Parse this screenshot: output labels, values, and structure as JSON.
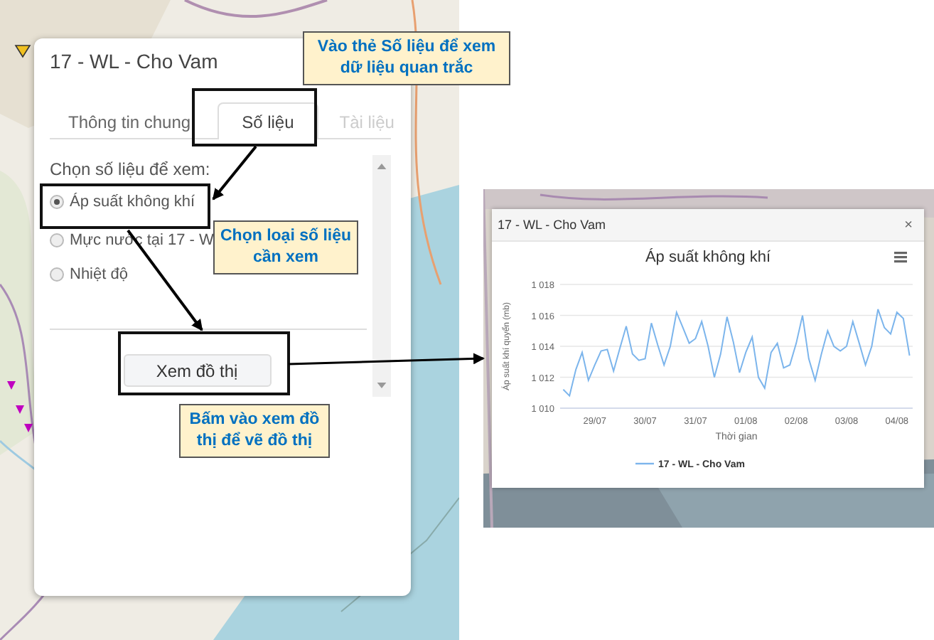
{
  "popup": {
    "title": "17 - WL - Cho Vam",
    "tabs": [
      {
        "label": "Thông tin chung",
        "selected": false,
        "disabled": false
      },
      {
        "label": "Số liệu",
        "selected": true,
        "disabled": false
      },
      {
        "label": "Tài liệu",
        "selected": false,
        "disabled": true
      }
    ],
    "prompt": "Chọn số liệu để xem:",
    "options": [
      {
        "label": "Áp suất không khí",
        "selected": true
      },
      {
        "label": "Mực nước tại 17 - W",
        "selected": false
      },
      {
        "label": "Nhiệt độ",
        "selected": false
      }
    ],
    "button": "Xem đồ thị"
  },
  "callouts": [
    "Vào thẻ Số liệu để xem dữ liệu quan trắc",
    "Chọn loại số liệu cần xem",
    "Bấm vào xem đồ thị để vẽ đồ thị"
  ],
  "chart_window": {
    "title": "17 - WL - Cho Vam",
    "close": "×",
    "chart_data": {
      "type": "line",
      "title": "Áp suất không khí",
      "xlabel": "Thời gian",
      "ylabel": "Áp suất khí quyển (mb)",
      "categories": [
        null,
        null,
        null,
        null,
        null,
        "29/07",
        null,
        null,
        null,
        null,
        null,
        null,
        null,
        "30/07",
        null,
        null,
        null,
        null,
        null,
        null,
        null,
        "31/07",
        null,
        null,
        null,
        null,
        null,
        null,
        null,
        "01/08",
        null,
        null,
        null,
        null,
        null,
        null,
        null,
        "02/08",
        null,
        null,
        null,
        null,
        null,
        null,
        null,
        "03/08",
        null,
        null,
        null,
        null,
        null,
        null,
        null,
        "04/08",
        null,
        null
      ],
      "series": [
        {
          "name": "17 - WL - Cho Vam",
          "color": "#7cb5ec",
          "values": [
            1011.2,
            1010.8,
            1012.5,
            1013.6,
            1011.8,
            1012.8,
            1013.7,
            1013.8,
            1012.4,
            1013.9,
            1015.3,
            1013.5,
            1013.1,
            1013.2,
            1015.5,
            1014.1,
            1012.8,
            1014.0,
            1016.2,
            1015.2,
            1014.2,
            1014.5,
            1015.6,
            1014.0,
            1012.0,
            1013.5,
            1015.9,
            1014.3,
            1012.3,
            1013.6,
            1014.6,
            1012.0,
            1011.3,
            1013.6,
            1014.2,
            1012.6,
            1012.8,
            1014.2,
            1016.0,
            1013.2,
            1011.8,
            1013.5,
            1015.0,
            1014.0,
            1013.7,
            1014.0,
            1015.6,
            1014.2,
            1012.8,
            1014.0,
            1016.4,
            1015.2,
            1014.8,
            1016.2,
            1015.8,
            1013.4
          ]
        }
      ],
      "ylim": [
        1010,
        1018
      ],
      "grid": true,
      "yticks": [
        {
          "value": 1010,
          "label": "1 010"
        },
        {
          "value": 1012,
          "label": "1 012"
        },
        {
          "value": 1014,
          "label": "1 014"
        },
        {
          "value": 1016,
          "label": "1 016"
        },
        {
          "value": 1018,
          "label": "1 018"
        }
      ]
    }
  }
}
